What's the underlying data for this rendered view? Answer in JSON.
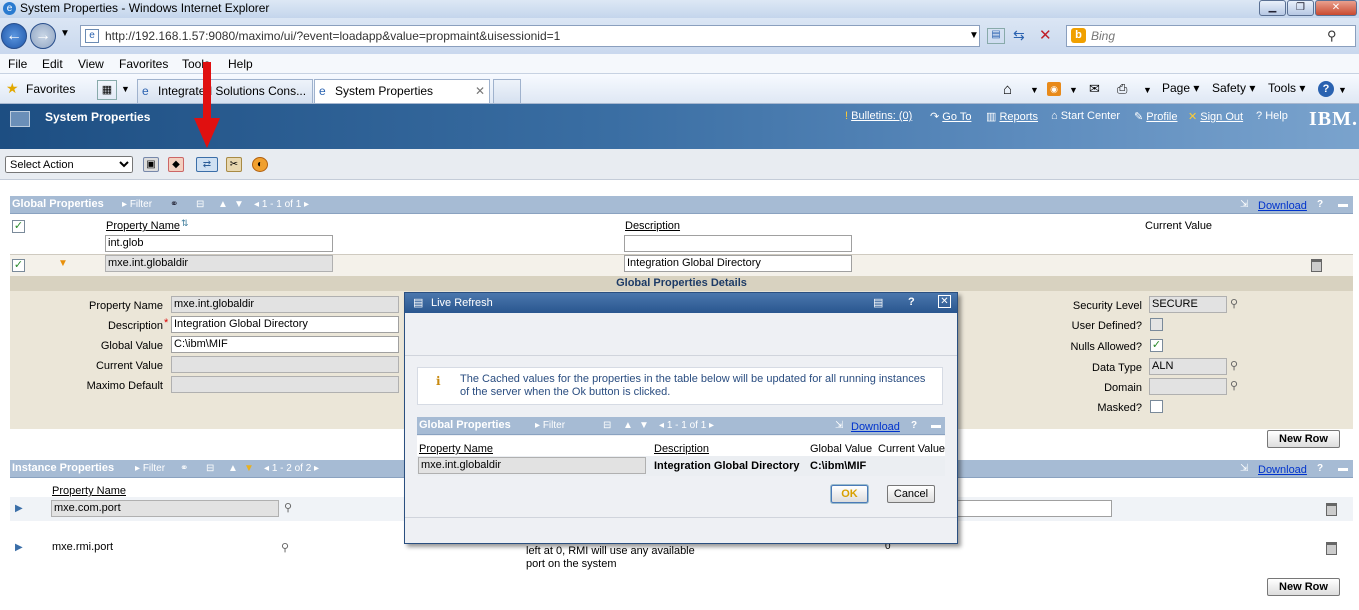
{
  "browser": {
    "window_title": "System Properties - Windows Internet Explorer",
    "url": "http://192.168.1.57:9080/maximo/ui/?event=loadapp&value=propmaint&uisessionid=1",
    "search_placeholder": "Bing",
    "menu": [
      "File",
      "Edit",
      "View",
      "Favorites",
      "Tools",
      "Help"
    ],
    "favorites_label": "Favorites",
    "tabs": [
      {
        "label": "Integrated Solutions Cons..."
      },
      {
        "label": "System Properties"
      }
    ],
    "command_bar": [
      "Page ▾",
      "Safety ▾",
      "Tools ▾"
    ]
  },
  "app": {
    "title": "System Properties",
    "header_links": [
      "Bulletins: (0)",
      "Go To",
      "Reports",
      "Start Center",
      "Profile",
      "Sign Out",
      "Help"
    ],
    "brand": "IBM.",
    "select_action": "Select Action"
  },
  "global": {
    "section_title": "Global Properties",
    "filter_label": "Filter",
    "paging": "1 - 1 of 1",
    "download": "Download",
    "columns": [
      "Property Name",
      "Description",
      "Current Value"
    ],
    "filter_values": {
      "name": "int.glob",
      "description": ""
    },
    "row": {
      "name": "mxe.int.globaldir",
      "description": "Integration Global Directory"
    },
    "details_title": "Global Properties Details",
    "details": {
      "property_name_label": "Property Name",
      "property_name": "mxe.int.globaldir",
      "description_label": "Description",
      "description": "Integration Global Directory",
      "global_value_label": "Global Value",
      "global_value": "C:\\ibm\\MIF",
      "current_value_label": "Current Value",
      "current_value": "",
      "maximo_default_label": "Maximo Default",
      "maximo_default": "",
      "security_level_label": "Security Level",
      "security_level": "SECURE",
      "user_defined_label": "User Defined?",
      "nulls_allowed_label": "Nulls Allowed?",
      "data_type_label": "Data Type",
      "data_type": "ALN",
      "domain_label": "Domain",
      "domain": "",
      "masked_label": "Masked?"
    },
    "new_row": "New Row"
  },
  "instance": {
    "section_title": "Instance Properties",
    "filter_label": "Filter",
    "paging": "1 - 2 of 2",
    "download": "Download",
    "column": "Property Name",
    "rows": [
      {
        "name": "mxe.com.port"
      },
      {
        "name": "mxe.rmi.port",
        "desc_line1": "left at 0, RMI will use any available",
        "desc_line2": "port on the system",
        "value": "0"
      }
    ],
    "new_row": "New Row"
  },
  "dialog": {
    "title": "Live Refresh",
    "message": "The Cached values for the properties in the table below will be updated for all running instances of the server when the Ok button is clicked.",
    "table_title": "Global Properties",
    "filter_label": "Filter",
    "paging": "1 - 1 of 1",
    "download": "Download",
    "columns": [
      "Property Name",
      "Description",
      "Global Value",
      "Current Value"
    ],
    "row": {
      "name": "mxe.int.globaldir",
      "description": "Integration Global Directory",
      "global_value": "C:\\ibm\\MIF",
      "current_value": ""
    },
    "ok": "OK",
    "cancel": "Cancel"
  }
}
